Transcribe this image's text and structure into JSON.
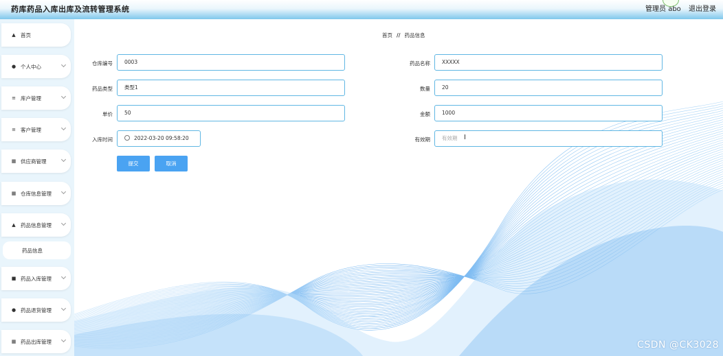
{
  "header": {
    "title": "药库药品入库出库及流转管理系统",
    "user": "管理员 abo",
    "logout": "退出登录"
  },
  "sidebar": {
    "items": [
      {
        "label": "首页",
        "icon": "home-icon"
      },
      {
        "label": "个人中心",
        "icon": "user-icon"
      },
      {
        "label": "库户管理",
        "icon": "list-icon"
      },
      {
        "label": "客户管理",
        "icon": "list-icon"
      },
      {
        "label": "供应商管理",
        "icon": "grid-icon"
      },
      {
        "label": "仓库信息管理",
        "icon": "grid-icon"
      },
      {
        "label": "药品信息管理",
        "icon": "upload-icon"
      },
      {
        "label": "药品信息",
        "icon": ""
      },
      {
        "label": "药品入库管理",
        "icon": "box-icon"
      },
      {
        "label": "药品退货管理",
        "icon": "user-icon"
      },
      {
        "label": "药品出库管理",
        "icon": "grid-icon"
      }
    ]
  },
  "breadcrumb": {
    "home": "首页",
    "separator": "//",
    "current": "药品信息"
  },
  "form": {
    "warehouse_no": {
      "label": "仓库编号",
      "value": "0003"
    },
    "drug_name": {
      "label": "药品名称",
      "value": "XXXXX"
    },
    "drug_type": {
      "label": "药品类型",
      "value": "类型1"
    },
    "quantity": {
      "label": "数量",
      "value": "20"
    },
    "unit_price": {
      "label": "单价",
      "value": "50"
    },
    "amount": {
      "label": "金额",
      "value": "1000"
    },
    "stock_in_time": {
      "label": "入库时间",
      "value": "2022-03-20 09:58:20"
    },
    "expiry": {
      "label": "有效期",
      "placeholder": "有效期"
    }
  },
  "buttons": {
    "submit": "提交",
    "cancel": "取消"
  },
  "watermark": "CSDN @CK3028",
  "colors": {
    "primary": "#4aa3f2",
    "border": "#5fb6e3",
    "sidebar_bg": "#e9f5fc",
    "wave": "#3d8fe0"
  }
}
